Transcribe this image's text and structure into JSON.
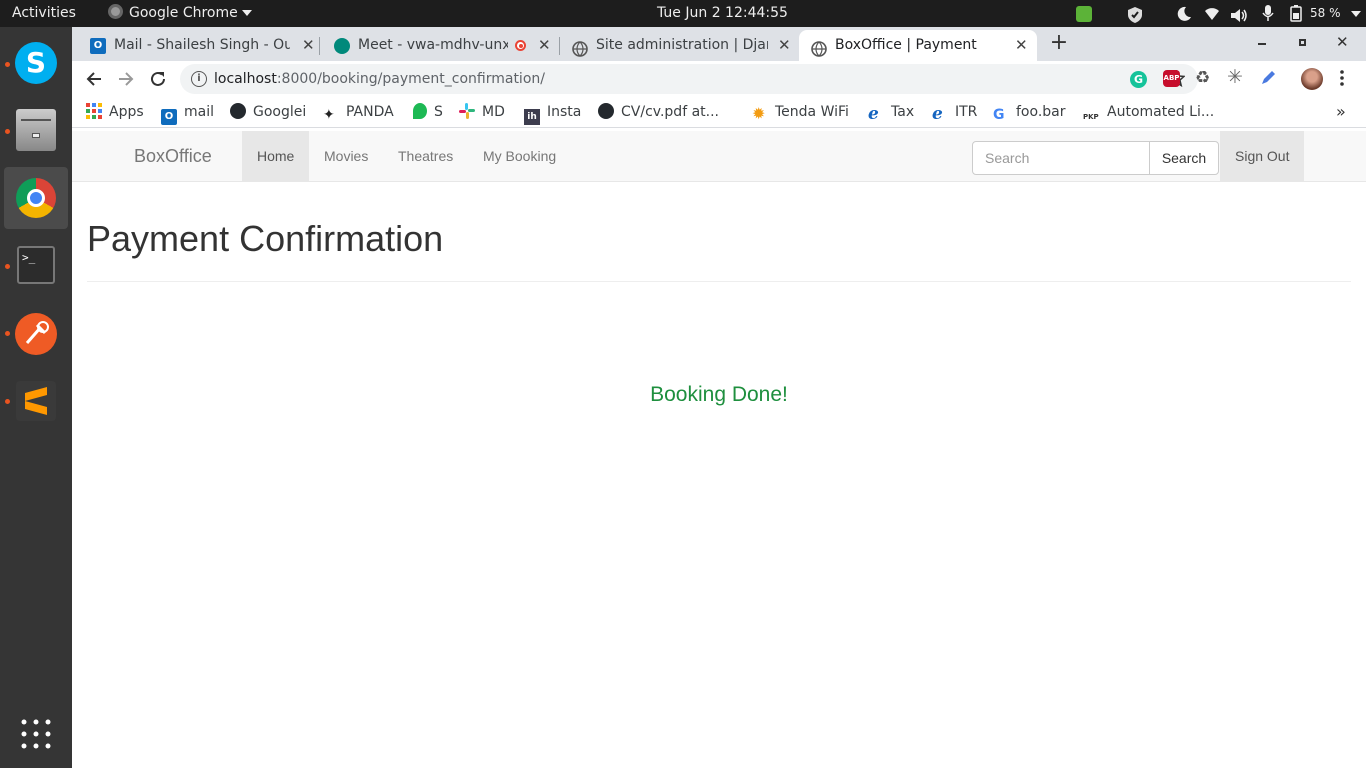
{
  "system": {
    "activities": "Activities",
    "app_menu": "Google Chrome",
    "clock": "Tue Jun 2  12:44:55",
    "battery": "58 %"
  },
  "tabs": [
    {
      "title": "Mail - Shailesh Singh - Out",
      "icon": "outlook-icon",
      "active": false
    },
    {
      "title": "Meet - vwa-mdhv-unx",
      "icon": "google-meet-icon",
      "active": false,
      "recording": true
    },
    {
      "title": "Site administration | Djan",
      "icon": "globe-icon",
      "active": false
    },
    {
      "title": "BoxOffice | Payment",
      "icon": "globe-icon",
      "active": true
    }
  ],
  "omnibox": {
    "host": "localhost",
    "path": ":8000/booking/payment_confirmation/"
  },
  "bookmarks": [
    {
      "label": "Apps",
      "icon": "apps-grid-icon"
    },
    {
      "label": "mail",
      "icon": "outlook-icon"
    },
    {
      "label": "Googlei",
      "icon": "github-icon"
    },
    {
      "label": "PANDA",
      "icon": "panda-icon"
    },
    {
      "label": "S",
      "icon": "s-leaf-icon"
    },
    {
      "label": "MD",
      "icon": "slack-icon"
    },
    {
      "label": "Insta",
      "icon": "ih-icon"
    },
    {
      "label": "CV/cv.pdf at...",
      "icon": "github-icon"
    },
    {
      "label": "Tenda WiFi",
      "icon": "tenda-gear-icon"
    },
    {
      "label": "Tax",
      "icon": "ie-icon"
    },
    {
      "label": "ITR",
      "icon": "ie-icon"
    },
    {
      "label": "foo.bar",
      "icon": "google-g-icon"
    },
    {
      "label": "Automated Li...",
      "icon": "pkp-icon"
    }
  ],
  "navbar": {
    "brand": "BoxOffice",
    "links": [
      "Home",
      "Movies",
      "Theatres",
      "My Booking"
    ],
    "active_link": "Home",
    "search_placeholder": "Search",
    "search_button": "Search",
    "sign_out": "Sign Out"
  },
  "main": {
    "title": "Payment Confirmation",
    "message": "Booking Done!"
  },
  "colors": {
    "success_text": "#1e8f3e",
    "navbar_bg": "#f8f8f8",
    "dock_bg": "#353535",
    "ubuntu_orange": "#e95420"
  }
}
